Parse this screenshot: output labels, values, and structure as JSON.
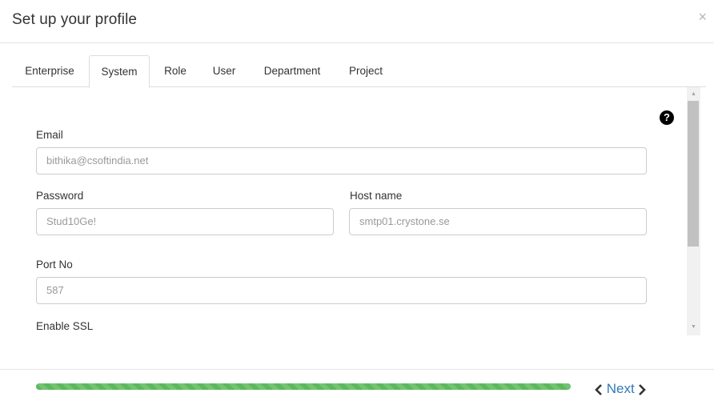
{
  "modal": {
    "title": "Set up your profile",
    "close_label": "×"
  },
  "tabs": [
    {
      "label": "Enterprise",
      "active": false
    },
    {
      "label": "System",
      "active": true
    },
    {
      "label": "Role",
      "active": false
    },
    {
      "label": "User",
      "active": false
    },
    {
      "label": "Department",
      "active": false
    },
    {
      "label": "Project",
      "active": false
    }
  ],
  "form": {
    "help_glyph": "?",
    "email": {
      "label": "Email",
      "value": "bithika@csoftindia.net"
    },
    "password": {
      "label": "Password",
      "value": "Stud10Ge!"
    },
    "host_name": {
      "label": "Host name",
      "value": "smtp01.crystone.se"
    },
    "port_no": {
      "label": "Port No",
      "value": "587"
    },
    "enable_ssl": {
      "label": "Enable SSL"
    }
  },
  "scrollbar": {
    "up_glyph": "▲",
    "down_glyph": "▼"
  },
  "footer": {
    "progress_fraction": 1.0,
    "progress_color": "#5cb85c",
    "next_label": "Next",
    "next_color": "#337ab7"
  }
}
